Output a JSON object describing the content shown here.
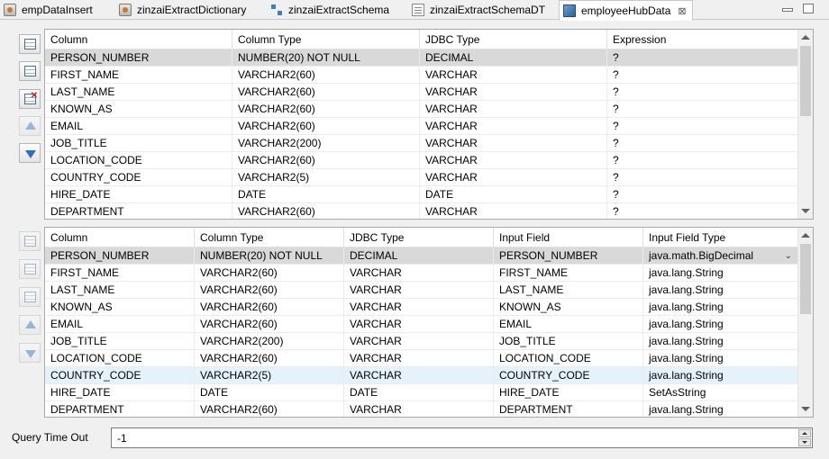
{
  "tabs": [
    {
      "label": "empDataInsert",
      "icon": "java-class-icon"
    },
    {
      "label": "zinzaiExtractDictionary",
      "icon": "dictionary-icon"
    },
    {
      "label": "zinzaiExtractSchema",
      "icon": "schema-icon"
    },
    {
      "label": "zinzaiExtractSchemaDT",
      "icon": "document-icon"
    },
    {
      "label": "employeeHubData",
      "icon": "hub-cube-icon",
      "active": true
    }
  ],
  "close_glyph": "⊠",
  "top_table": {
    "headers": [
      "Column",
      "Column Type",
      "JDBC Type",
      "Expression"
    ],
    "rows": [
      [
        "PERSON_NUMBER",
        "NUMBER(20) NOT NULL",
        "DECIMAL",
        "?"
      ],
      [
        "FIRST_NAME",
        "VARCHAR2(60)",
        "VARCHAR",
        "?"
      ],
      [
        "LAST_NAME",
        "VARCHAR2(60)",
        "VARCHAR",
        "?"
      ],
      [
        "KNOWN_AS",
        "VARCHAR2(60)",
        "VARCHAR",
        "?"
      ],
      [
        "EMAIL",
        "VARCHAR2(60)",
        "VARCHAR",
        "?"
      ],
      [
        "JOB_TITLE",
        "VARCHAR2(200)",
        "VARCHAR",
        "?"
      ],
      [
        "LOCATION_CODE",
        "VARCHAR2(60)",
        "VARCHAR",
        "?"
      ],
      [
        "COUNTRY_CODE",
        "VARCHAR2(5)",
        "VARCHAR",
        "?"
      ],
      [
        "HIRE_DATE",
        "DATE",
        "DATE",
        "?"
      ],
      [
        "DEPARTMENT",
        "VARCHAR2(60)",
        "VARCHAR",
        "?"
      ]
    ]
  },
  "bottom_table": {
    "headers": [
      "Column",
      "Column Type",
      "JDBC Type",
      "Input Field",
      "Input Field Type"
    ],
    "rows": [
      [
        "PERSON_NUMBER",
        "NUMBER(20) NOT NULL",
        "DECIMAL",
        "PERSON_NUMBER",
        "java.math.BigDecimal"
      ],
      [
        "FIRST_NAME",
        "VARCHAR2(60)",
        "VARCHAR",
        "FIRST_NAME",
        "java.lang.String"
      ],
      [
        "LAST_NAME",
        "VARCHAR2(60)",
        "VARCHAR",
        "LAST_NAME",
        "java.lang.String"
      ],
      [
        "KNOWN_AS",
        "VARCHAR2(60)",
        "VARCHAR",
        "KNOWN_AS",
        "java.lang.String"
      ],
      [
        "EMAIL",
        "VARCHAR2(60)",
        "VARCHAR",
        "EMAIL",
        "java.lang.String"
      ],
      [
        "JOB_TITLE",
        "VARCHAR2(200)",
        "VARCHAR",
        "JOB_TITLE",
        "java.lang.String"
      ],
      [
        "LOCATION_CODE",
        "VARCHAR2(60)",
        "VARCHAR",
        "LOCATION_CODE",
        "java.lang.String"
      ],
      [
        "COUNTRY_CODE",
        "VARCHAR2(5)",
        "VARCHAR",
        "COUNTRY_CODE",
        "java.lang.String"
      ],
      [
        "HIRE_DATE",
        "DATE",
        "DATE",
        "HIRE_DATE",
        "SetAsString"
      ],
      [
        "DEPARTMENT",
        "VARCHAR2(60)",
        "VARCHAR",
        "DEPARTMENT",
        "java.lang.String"
      ]
    ]
  },
  "query_timeout": {
    "label": "Query Time Out",
    "value": "-1"
  },
  "colors": {
    "selected_row": "#d9d9d9",
    "hover_row": "#e5f1fb",
    "icon_blue": "#2e6fb8",
    "delete_red": "#d0202a"
  }
}
